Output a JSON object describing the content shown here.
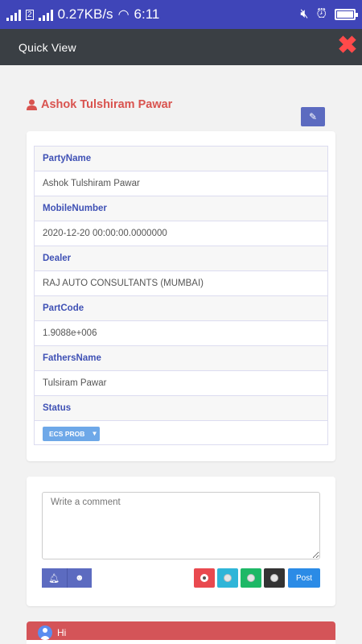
{
  "status_bar": {
    "network_speed": "0.27KB/s",
    "time": "6:11",
    "sim_label": "2",
    "battery_level": 0.9
  },
  "header": {
    "title": "Quick View",
    "close_icon": "close-icon"
  },
  "party": {
    "name": "Ashok Tulshiram Pawar",
    "icon": "user-icon"
  },
  "details": [
    {
      "label": "PartyName",
      "value": "Ashok Tulshiram Pawar"
    },
    {
      "label": "MobileNumber",
      "value": "2020-12-20 00:00:00.0000000"
    },
    {
      "label": "Dealer",
      "value": "RAJ AUTO CONSULTANTS (MUMBAI)"
    },
    {
      "label": "PartCode",
      "value": "1.9088e+006"
    },
    {
      "label": "FathersName",
      "value": "Tulsiram Pawar"
    },
    {
      "label": "Status",
      "value": "ECS PROB"
    }
  ],
  "comment": {
    "placeholder": "Write a comment",
    "post_label": "Post",
    "colors": [
      "#e9494f",
      "#2fb5d8",
      "#1eb866",
      "#333333"
    ]
  },
  "message": {
    "text": "Hi",
    "color": "#d45458"
  }
}
